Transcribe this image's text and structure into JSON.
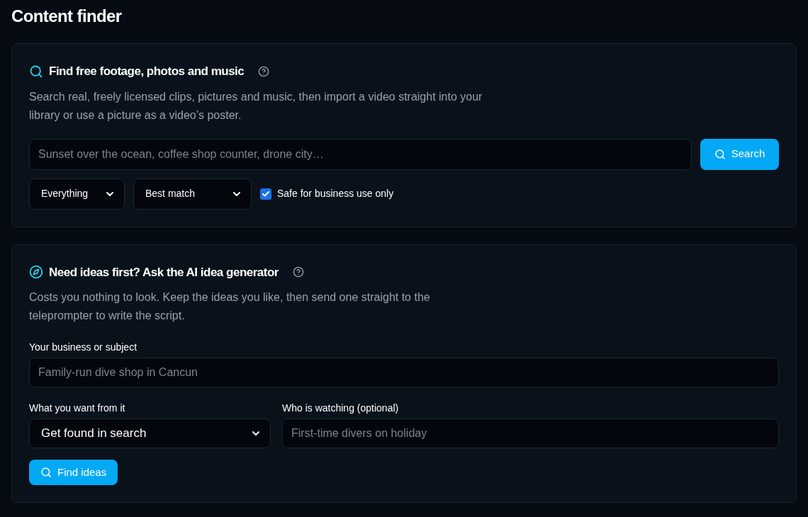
{
  "page_title": "Content finder",
  "footage_panel": {
    "heading": "Find free footage, photos and music",
    "description": "Search real, freely licensed clips, pictures and music, then import a video straight into your library or use a picture as a video’s poster.",
    "search": {
      "placeholder": "Sunset over the ocean, coffee shop counter, drone city…"
    },
    "search_button": "Search",
    "media_type": {
      "value": "Everything"
    },
    "sort": {
      "value": "Best match"
    },
    "safe_filter": {
      "label": "Safe for business use only",
      "checked": true
    }
  },
  "ideas_panel": {
    "heading": "Need ideas first? Ask the AI idea generator",
    "description": "Costs you nothing to look. Keep the ideas you like, then send one straight to the teleprompter to write the script.",
    "subject": {
      "label": "Your business or subject",
      "placeholder": "Family-run dive shop in Cancun"
    },
    "goal": {
      "label": "What you want from it",
      "value": "Get found in search"
    },
    "audience": {
      "label": "Who is watching (optional)",
      "placeholder": "First-time divers on holiday"
    },
    "button": "Find ideas"
  }
}
